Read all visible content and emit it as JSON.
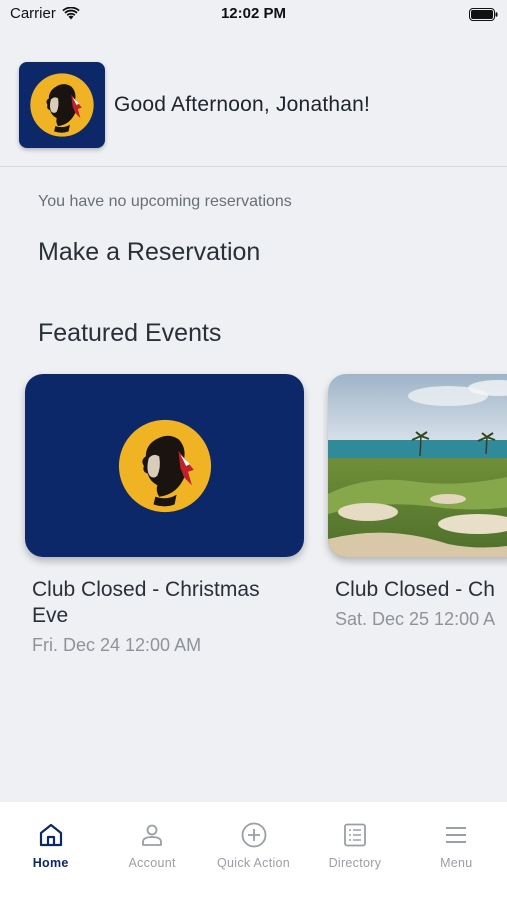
{
  "status": {
    "carrier": "Carrier",
    "time": "12:02 PM",
    "wifi_icon": "wifi-icon",
    "battery_icon": "battery-icon"
  },
  "header": {
    "logo": "club-logo",
    "greeting": "Good Afternoon, Jonathan!"
  },
  "reservations": {
    "empty_text": "You have no upcoming reservations",
    "make_label": "Make a Reservation"
  },
  "featured": {
    "title": "Featured Events",
    "events": [
      {
        "name": "Club Closed - Christmas Eve",
        "date": "Fri. Dec 24 12:00 AM",
        "image": "club-logo"
      },
      {
        "name": "Club Closed - Ch",
        "date": "Sat. Dec 25 12:00 A",
        "image": "golf-course-photo"
      }
    ]
  },
  "tabs": [
    {
      "label": "Home",
      "icon": "home-icon",
      "active": true
    },
    {
      "label": "Account",
      "icon": "account-icon",
      "active": false
    },
    {
      "label": "Quick Action",
      "icon": "plus-circle-icon",
      "active": false
    },
    {
      "label": "Directory",
      "icon": "directory-icon",
      "active": false
    },
    {
      "label": "Menu",
      "icon": "menu-icon",
      "active": false
    }
  ],
  "colors": {
    "brand_navy": "#0d2868",
    "logo_gold": "#f0b323",
    "background": "#eef0f4"
  }
}
